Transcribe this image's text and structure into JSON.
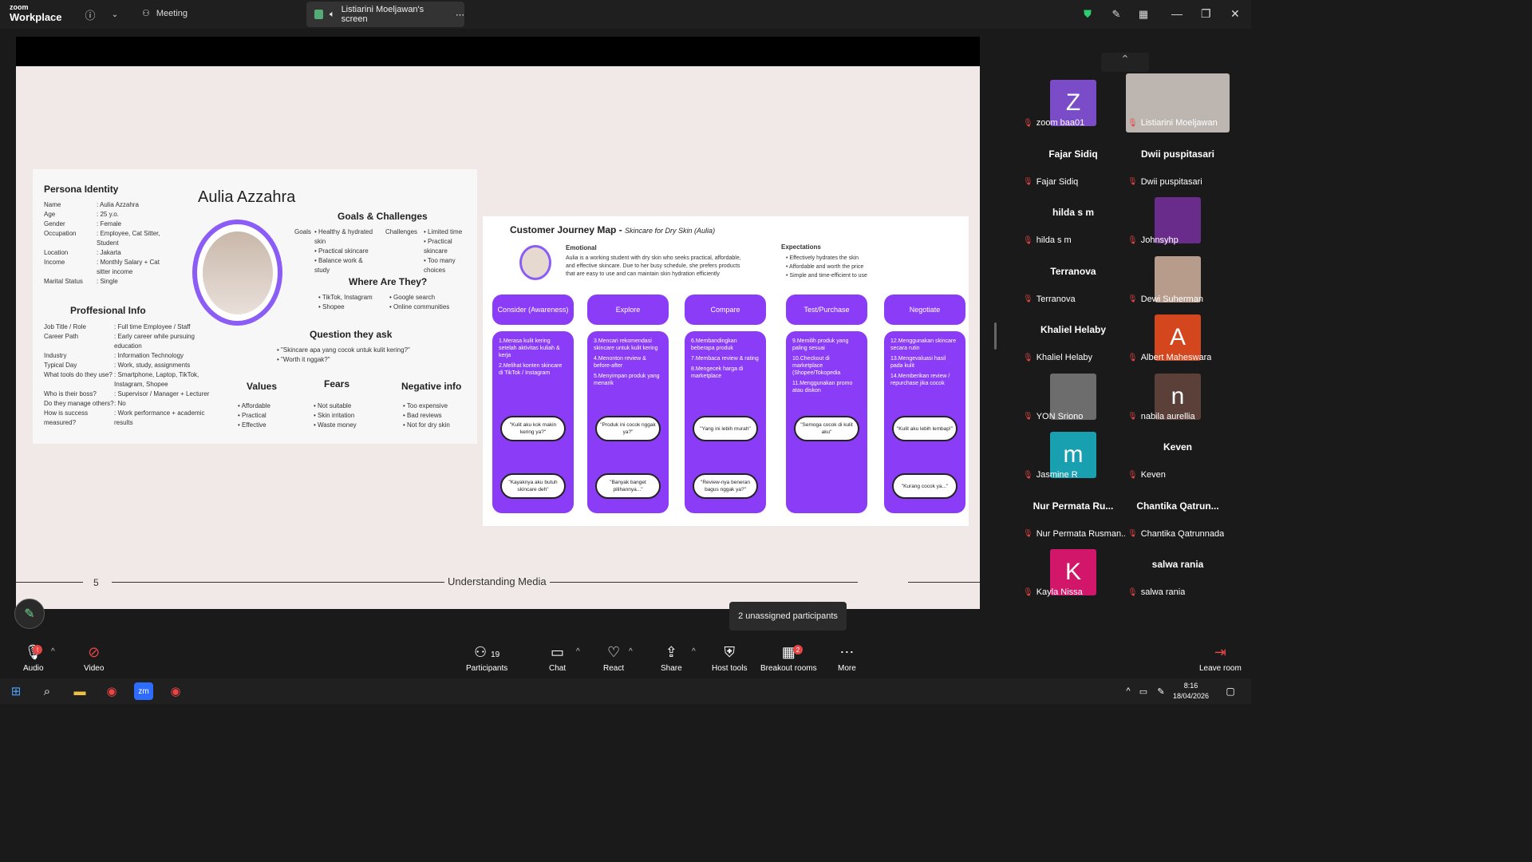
{
  "app": {
    "brand_top": "zoom",
    "brand_bottom": "Workplace",
    "meeting_label": "Meeting",
    "screen_tab": "Listiarini Moeljawan's screen"
  },
  "slide": {
    "persona_identity_heading": "Persona Identity",
    "persona_name": "Aulia Azzahra",
    "identity": [
      {
        "k": "Name",
        "v": ": Aulia Azzahra"
      },
      {
        "k": "Age",
        "v": ": 25 y.o."
      },
      {
        "k": "Gender",
        "v": ": Female"
      },
      {
        "k": "Occupation",
        "v": ": Employee, Cat Sitter, Student"
      },
      {
        "k": "Location",
        "v": ": Jakarta"
      },
      {
        "k": "Income",
        "v": ": Monthly Salary + Cat sitter income"
      },
      {
        "k": "Marital Status",
        "v": ": Single"
      }
    ],
    "professional_heading": "Proffesional Info",
    "professional": [
      {
        "k": "Job Title / Role",
        "v": ": Full time Employee / Staff"
      },
      {
        "k": "Career Path",
        "v": ": Early career while pursuing education"
      },
      {
        "k": "Industry",
        "v": ": Information Technology"
      },
      {
        "k": "Typical Day",
        "v": ": Work, study, assignments"
      },
      {
        "k": "What tools do they use?",
        "v": ": Smartphone, Laptop, TikTok, Instagram, Shopee"
      },
      {
        "k": "Who is their boss?",
        "v": ": Supervisor / Manager + Lecturer"
      },
      {
        "k": "Do they manage others?",
        "v": ": No"
      },
      {
        "k": "How is success measured?",
        "v": ": Work performance + academic results"
      }
    ],
    "goals_heading": "Goals & Challenges",
    "goals_label": "Goals",
    "goals": [
      "Healthy & hydrated skin",
      "Practical skincare",
      "Balance work & study"
    ],
    "challenges_label": "Challenges",
    "challenges": [
      "Limited time",
      "Practical skincare",
      "Too many choices"
    ],
    "where_heading": "Where Are They?",
    "where_left": [
      "TikTok, Instagram",
      "Shopee"
    ],
    "where_right": [
      "Google search",
      "Online communities"
    ],
    "question_heading": "Question they ask",
    "questions": [
      "\"Skincare apa yang cocok untuk kulit kering?\"",
      "\"Worth it nggak?\""
    ],
    "values_heading": "Values",
    "values": [
      "Affordable",
      "Practical",
      "Effective"
    ],
    "fears_heading": "Fears",
    "fears": [
      "Not suitable",
      "Skin irritation",
      "Waste money"
    ],
    "negative_heading": "Negative info",
    "negative": [
      "Too expensive",
      "Bad reviews",
      "Not for dry skin"
    ],
    "journey_title": "Customer Journey Map - ",
    "journey_subtitle": "Skincare for Dry Skin (Aulia)",
    "emotional_heading": "Emotional",
    "emotional_text": "Aulia is a working student with dry skin who seeks practical, affordable, and effective skincare. Due to her busy schedule, she prefers products that are easy to use and can maintain skin hydration efficiently",
    "expectations_heading": "Expectations",
    "expectations": [
      "Effectively hydrates the skin",
      "Affordable and worth the price",
      "Simple and time-efficient to use"
    ],
    "stages": [
      {
        "name": "Consider (Awareness)",
        "steps": [
          "1.Merasa kulit kering setelah aktivitas kuliah & kerja",
          "2.Melihat konten skincare di TikTok / Instagram"
        ],
        "q1": "\"Kulit aku kok makin kering ya?\"",
        "q2": "\"Kayaknya aku butuh skincare deh\""
      },
      {
        "name": "Explore",
        "steps": [
          "3.Mencari rekomendasi skincare untuk kulit kering",
          "4.Menonton review & before-after",
          "5.Menyimpan produk yang menarik"
        ],
        "q1": "\"Produk ini cocok nggak ya?\"",
        "q2": "\"Banyak banget pilihannya...\""
      },
      {
        "name": "Compare",
        "steps": [
          "6.Membandingkan beberapa produk",
          "7.Membaca review & rating",
          "8.Mengecek harga di marketplace"
        ],
        "q1": "\"Yang ini lebih murah\"",
        "q2": "\"Review-nya beneran bagus nggak ya?\""
      },
      {
        "name": "Test/Purchase",
        "steps": [
          "9.Memilih produk yang paling sesuai",
          "10.Checkout di marketplace (Shopee/Tokopedia",
          "11.Menggunakan promo atau diskon"
        ],
        "q1": "\"Semoga cocok di kulit aku\"",
        "q2": ""
      },
      {
        "name": "Negotiate",
        "steps": [
          "12.Menggunakan skincare secara rutin",
          "13.Mengevaluasi hasil pada kulit",
          "14.Memberikan review / repurchase jika cocok"
        ],
        "q1": "\"Kulit aku lebih lembap!\"",
        "q2": "\"Kurang cocok ya...\""
      }
    ],
    "slide_number": "5",
    "footer_title": "Understanding Media"
  },
  "participants": [
    {
      "display": "Z",
      "label": "zoom baa01",
      "bg": "#7b4cc8"
    },
    {
      "display": "video",
      "label": "Listiarini Moeljawan",
      "bg": "#bdb6b0"
    },
    {
      "display": "name",
      "big": "Fajar Sidiq",
      "label": "Fajar Sidiq"
    },
    {
      "display": "name",
      "big": "Dwii puspitasari",
      "label": "Dwii puspitasari"
    },
    {
      "display": "name",
      "big": "hilda s m",
      "label": "hilda s m"
    },
    {
      "display": "img",
      "label": "Johnsyhp",
      "bg": "#6a2c8a"
    },
    {
      "display": "name",
      "big": "Terranova",
      "label": "Terranova"
    },
    {
      "display": "img",
      "label": "Dewi Suherman",
      "bg": "#b79c8c"
    },
    {
      "display": "name",
      "big": "Khaliel Helaby",
      "label": "Khaliel Helaby"
    },
    {
      "display": "A",
      "label": "Albert Maheswara",
      "bg": "#d4461e"
    },
    {
      "display": "img",
      "label": "YON Sriono",
      "bg": "#6d6d6d"
    },
    {
      "display": "n",
      "label": "nabila aurellia",
      "bg": "#5a4039"
    },
    {
      "display": "m",
      "label": "Jasmine R",
      "bg": "#18a0b0"
    },
    {
      "display": "name",
      "big": "Keven",
      "label": "Keven"
    },
    {
      "display": "name",
      "big": "Nur Permata Ru...",
      "label": "Nur Permata Rusman..."
    },
    {
      "display": "name",
      "big": "Chantika  Qatrun...",
      "label": "Chantika Qatrunnada"
    },
    {
      "display": "K",
      "label": "Kayla Nissa",
      "bg": "#d2176a"
    },
    {
      "display": "name",
      "big": "salwa rania",
      "label": "salwa rania"
    }
  ],
  "tooltip": "2 unassigned participants",
  "toolbar": {
    "audio": "Audio",
    "video": "Video",
    "participants": "Participants",
    "participant_count": "19",
    "chat": "Chat",
    "react": "React",
    "share": "Share",
    "host_tools": "Host tools",
    "breakout": "Breakout rooms",
    "breakout_badge": "2",
    "more": "More",
    "leave": "Leave room"
  },
  "taskbar": {
    "time": "8:16",
    "date": "18/04/2026"
  }
}
